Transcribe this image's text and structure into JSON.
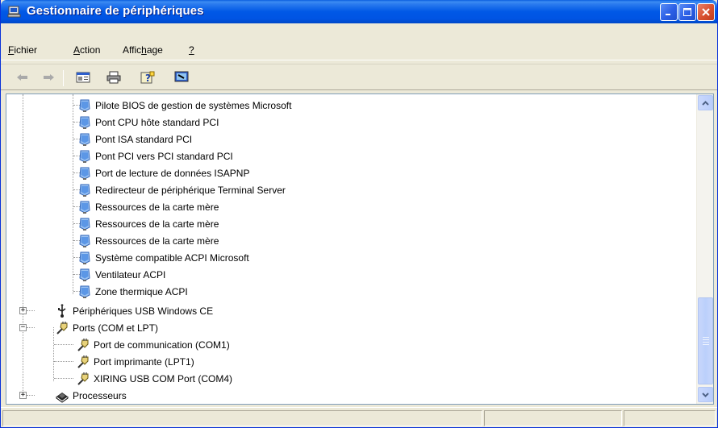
{
  "window": {
    "title": "Gestionnaire de périphériques"
  },
  "menu": {
    "items": [
      {
        "label": "Fichier",
        "accesskey": "F"
      },
      {
        "label": "Action",
        "accesskey": "A"
      },
      {
        "label": "Affichage",
        "accesskey": "h"
      },
      {
        "label": "?",
        "accesskey": "?"
      }
    ]
  },
  "toolbar": {
    "buttons": [
      "back-arrow-icon",
      "forward-arrow-icon",
      "properties-console-icon",
      "print-icon",
      "help-icon",
      "scan-hardware-icon"
    ]
  },
  "tree": {
    "system_devices": [
      "Pilote BIOS de gestion de systèmes Microsoft",
      "Pont CPU hôte standard PCI",
      "Pont ISA standard PCI",
      "Pont PCI vers PCI standard PCI",
      "Port de lecture de données ISAPNP",
      "Redirecteur de périphérique Terminal Server",
      "Ressources de la carte mère",
      "Ressources de la carte mère",
      "Ressources de la carte mère",
      "Système compatible ACPI Microsoft",
      "Ventilateur ACPI",
      "Zone thermique ACPI"
    ],
    "usb_ce": "Périphériques USB Windows CE",
    "ports_category": "Ports (COM et LPT)",
    "ports": [
      "Port de communication (COM1)",
      "Port imprimante (LPT1)",
      "XIRING USB COM Port (COM4)"
    ],
    "processors": "Processeurs"
  }
}
